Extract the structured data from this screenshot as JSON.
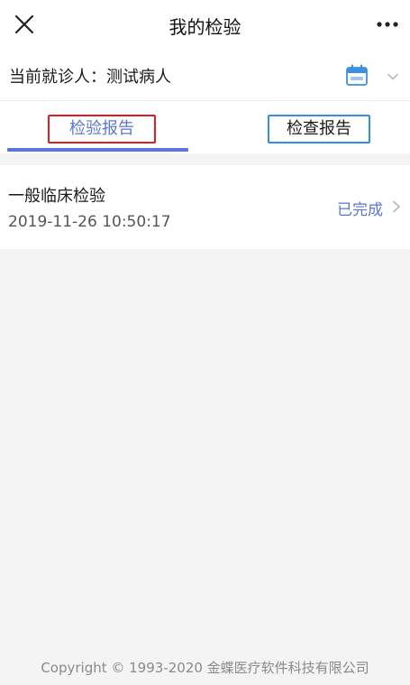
{
  "nav": {
    "title": "我的检验",
    "close_icon": "close-icon",
    "more_icon": "more-dots-icon"
  },
  "patient": {
    "label": "当前就诊人：测试病人",
    "calendar_icon": "calendar-icon",
    "dropdown_icon": "chevron-down-icon"
  },
  "tabs": [
    {
      "label": "检验报告",
      "active": true
    },
    {
      "label": "检查报告",
      "active": false
    }
  ],
  "reports": [
    {
      "title": "一般临床检验",
      "time": "2019-11-26 10:50:17",
      "status": "已完成"
    }
  ],
  "footer": {
    "copyright": "Copyright © 1993-2020 金蝶医疗软件科技有限公司"
  },
  "colors": {
    "accent": "#5b76d6",
    "highlight_red": "#e02020",
    "highlight_blue": "#2f8ef0",
    "background": "#f4f4f4"
  }
}
